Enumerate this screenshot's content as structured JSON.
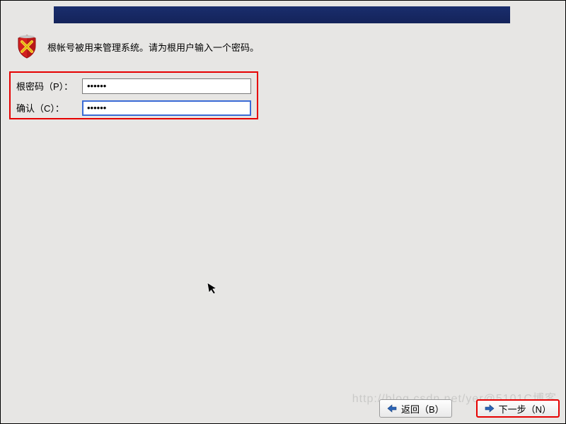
{
  "instruction": "根帐号被用来管理系统。请为根用户输入一个密码。",
  "form": {
    "password_label": "根密码（P）：",
    "password_value": "••••••",
    "confirm_label": "确认（C）：",
    "confirm_value": "••••••"
  },
  "buttons": {
    "back_label": "返回（B）",
    "next_label": "下一步（N）"
  },
  "watermark": "http://blog.csdn.net/yer@5101C博客",
  "icons": {
    "shield": "shield-icon",
    "arrow_left": "arrow-left-icon",
    "arrow_right": "arrow-right-icon",
    "cursor": "cursor-icon"
  },
  "colors": {
    "banner": "#14235a",
    "highlight_border": "#e60000",
    "focus_border": "#3a6bd6"
  }
}
